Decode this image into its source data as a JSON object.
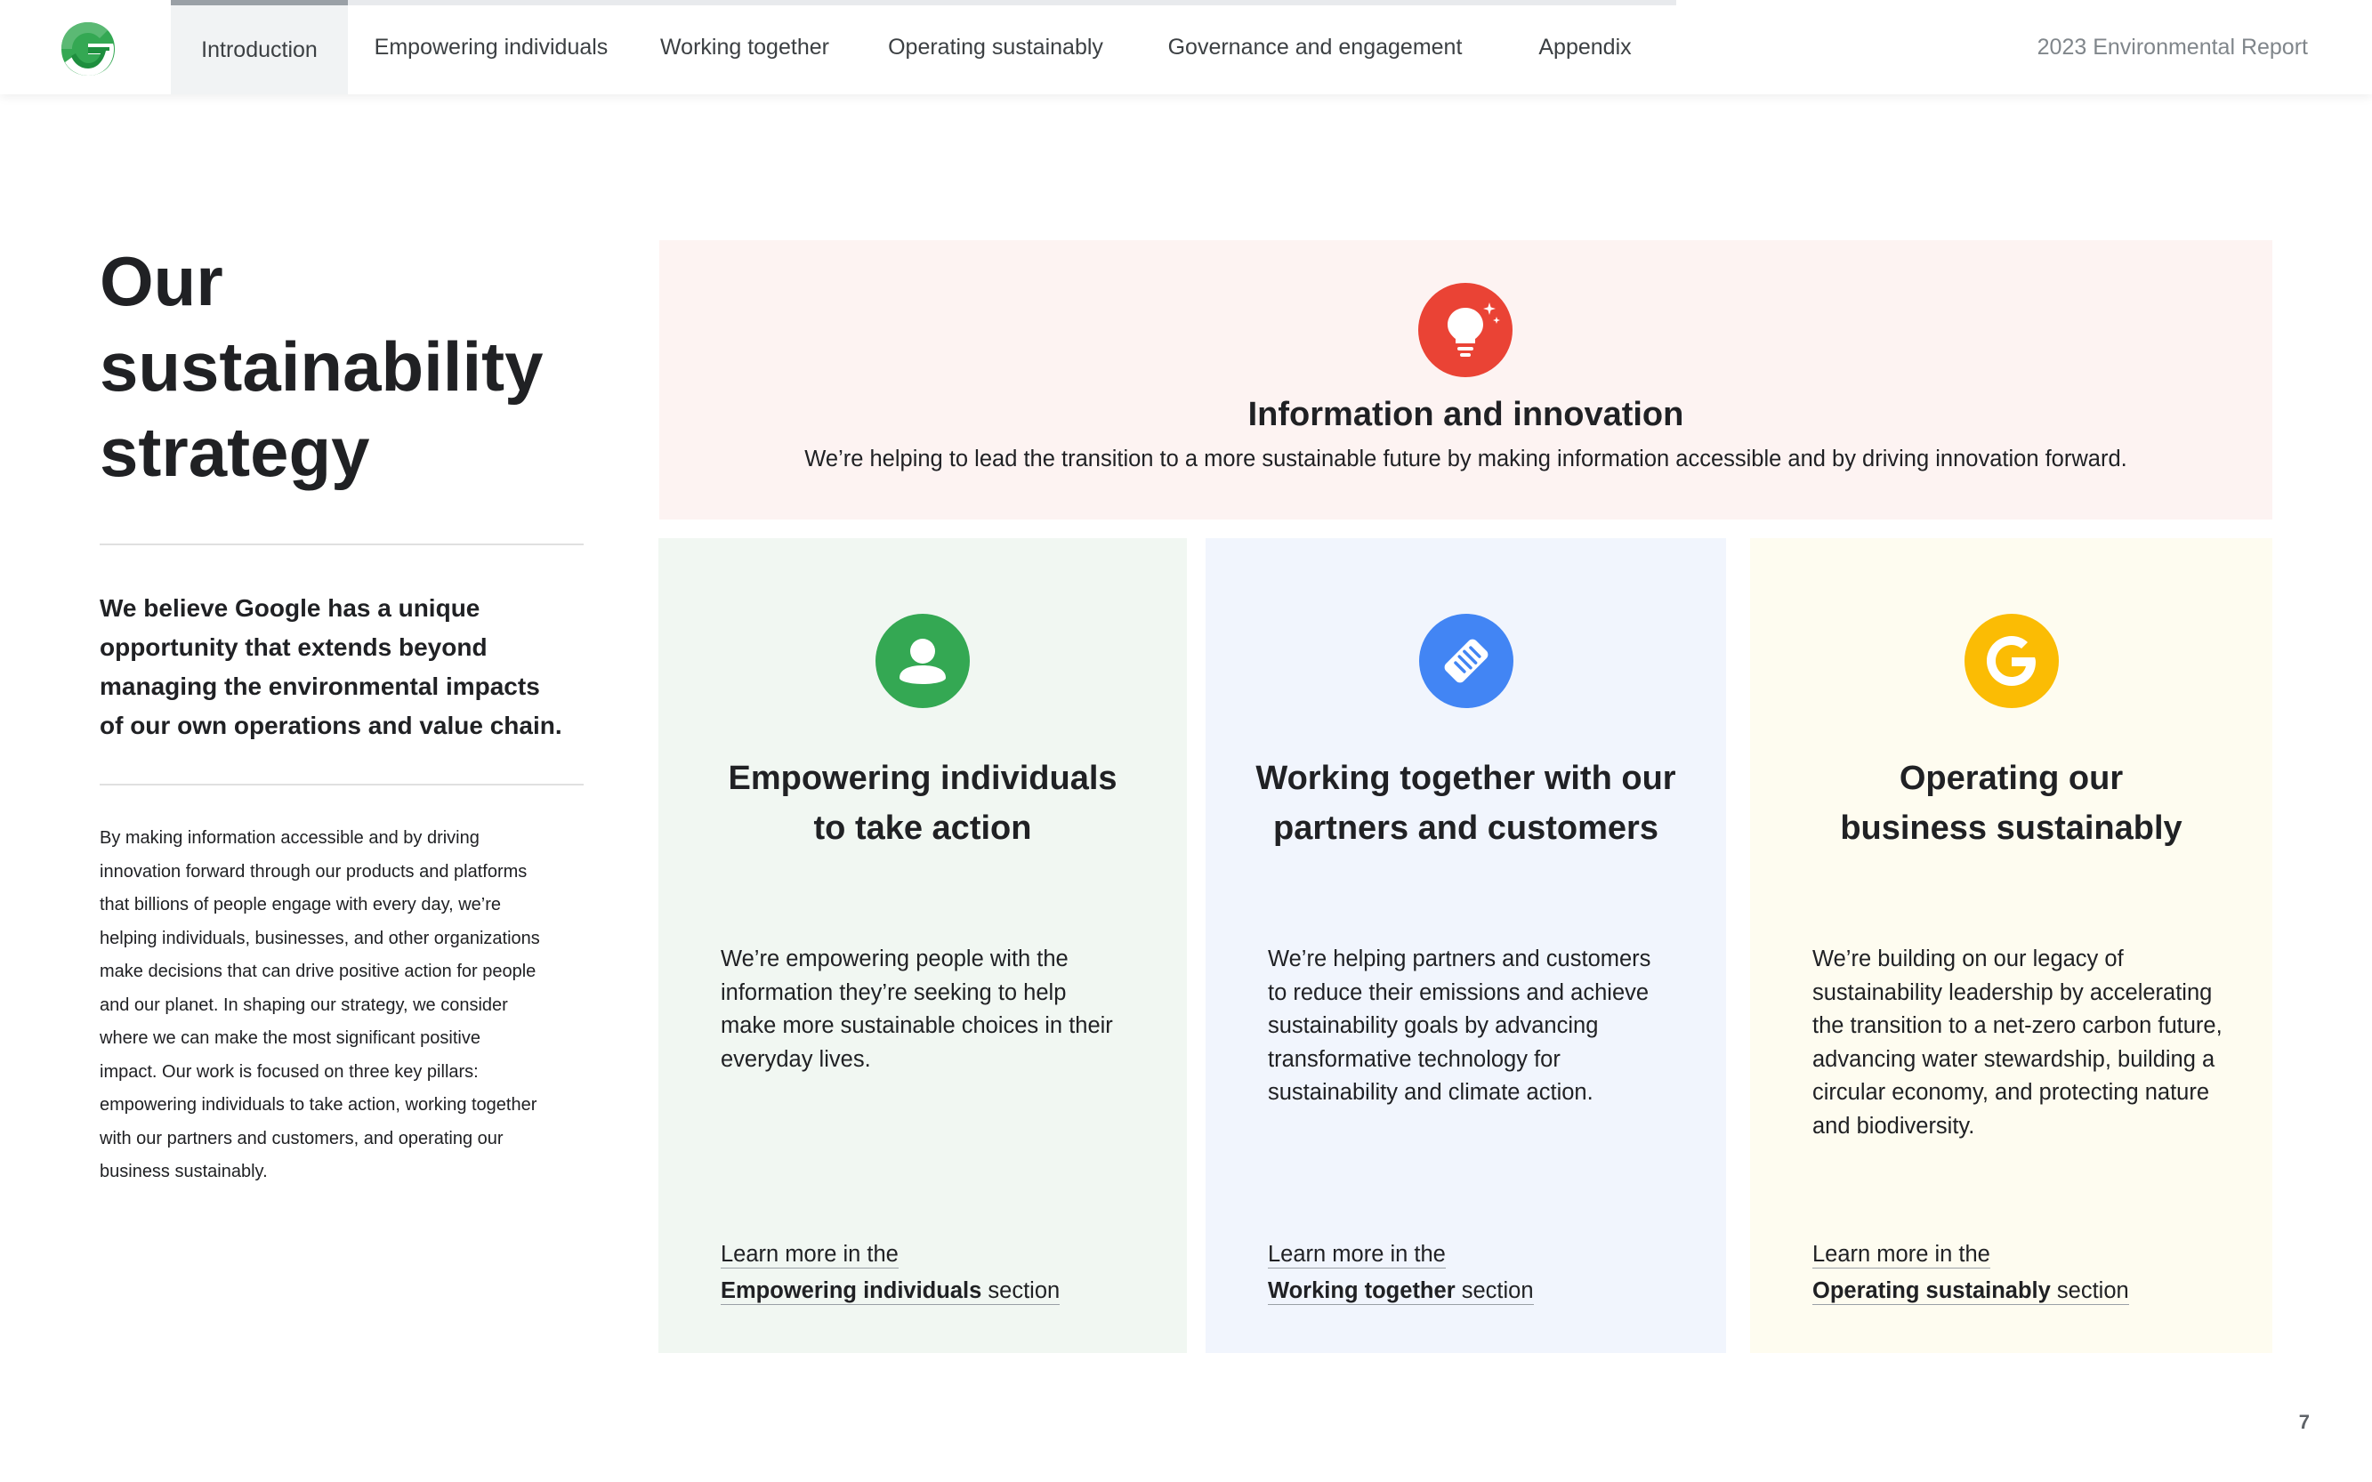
{
  "nav": {
    "tabs": [
      {
        "label": "Introduction",
        "active": true
      },
      {
        "label": "Empowering individuals",
        "active": false
      },
      {
        "label": "Working together",
        "active": false
      },
      {
        "label": "Operating sustainably",
        "active": false
      },
      {
        "label": "Governance and engagement",
        "active": false
      },
      {
        "label": "Appendix",
        "active": false
      }
    ],
    "report_title": "2023 Environmental Report"
  },
  "intro": {
    "title_lines": [
      "Our",
      "sustainability",
      "strategy"
    ],
    "lead_lines": [
      "We believe Google has a unique",
      "opportunity that extends beyond",
      "managing the environmental impacts",
      "of our own operations and value chain."
    ],
    "body_lines": [
      "By making information accessible and by driving",
      "innovation forward through our products and platforms",
      "that billions of people engage with every day, we’re",
      "helping individuals, businesses, and other organizations",
      "make decisions that can drive positive action for people",
      "and our planet. In shaping our strategy, we consider",
      "where we can make the most significant positive",
      "impact. Our work is focused on three key pillars:",
      "empowering individuals to take action, working together",
      "with our partners and customers, and operating our",
      "business sustainably."
    ]
  },
  "info_panel": {
    "icon": "lightbulb-icon",
    "title": "Information and innovation",
    "description": "We’re helping to lead the transition to a more sustainable future by making information accessible and by driving innovation forward."
  },
  "pillars": [
    {
      "icon": "person-icon",
      "title_lines": [
        "Empowering individuals",
        "to take action"
      ],
      "desc_lines": [
        "We’re empowering people with the",
        "information they’re seeking to help",
        "make more sustainable choices in their",
        "everyday lives."
      ],
      "link_prefix": "Learn more in the",
      "link_bold": "Empowering individuals",
      "link_suffix": " section"
    },
    {
      "icon": "handshake-icon",
      "title_lines": [
        "Working together with our",
        "partners and customers"
      ],
      "desc_lines": [
        "We’re helping partners and customers",
        "to reduce their emissions and achieve",
        "sustainability goals by advancing",
        "transformative technology for",
        "sustainability and climate action."
      ],
      "link_prefix": "Learn more in the",
      "link_bold": "Working together",
      "link_suffix": " section"
    },
    {
      "icon": "google-g-icon",
      "title_lines": [
        "Operating our",
        "business sustainably"
      ],
      "desc_lines": [
        "We’re building on our legacy of",
        "sustainability leadership by accelerating",
        "the transition to a net-zero carbon future,",
        "advancing water stewardship, building a",
        "circular economy, and protecting nature",
        "and biodiversity."
      ],
      "link_prefix": "Learn more in the",
      "link_bold": "Operating sustainably",
      "link_suffix": " section"
    }
  ],
  "colors": {
    "red": "#ea4335",
    "green": "#34a853",
    "blue": "#4285f4",
    "yellow": "#fbbc04"
  },
  "page_number": "7"
}
